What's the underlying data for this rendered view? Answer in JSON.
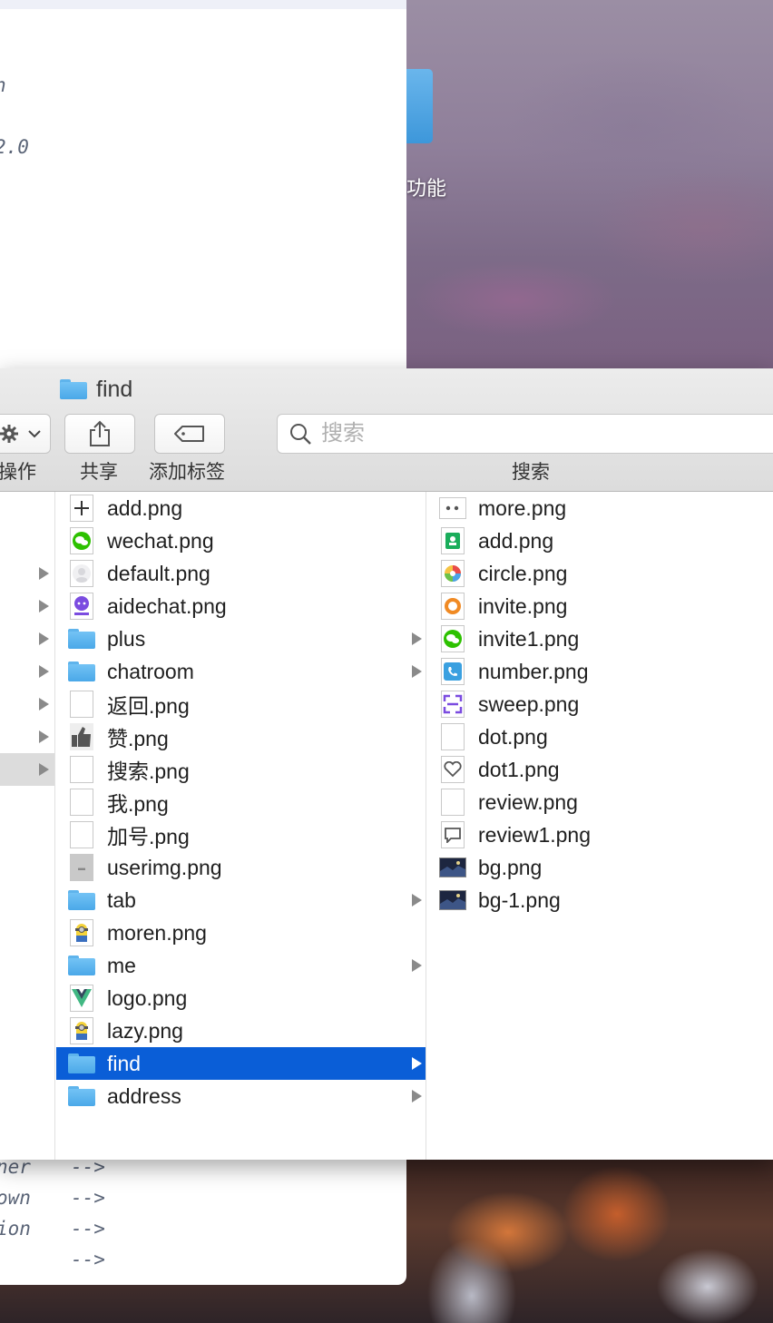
{
  "editor": {
    "lines": [
      "n",
      "2.0"
    ],
    "bottom_lines": [
      {
        "left": "ner",
        "right": "-->"
      },
      {
        "left": "own",
        "right": "-->"
      },
      {
        "left": "ion",
        "right": "-->"
      },
      {
        "left": "",
        "right": "-->"
      }
    ]
  },
  "desktop": {
    "folder_label": "功能"
  },
  "finder": {
    "title": "find",
    "toolbar": {
      "action_label": "操作",
      "share_label": "共享",
      "tag_label": "添加标签",
      "search_label": "搜索",
      "search_placeholder": "搜索"
    },
    "column1_rows": [
      {
        "arrow": false,
        "selected": false
      },
      {
        "arrow": false,
        "selected": false
      },
      {
        "arrow": true,
        "selected": false
      },
      {
        "arrow": true,
        "selected": false
      },
      {
        "arrow": true,
        "selected": false
      },
      {
        "arrow": true,
        "selected": false
      },
      {
        "arrow": true,
        "selected": false
      },
      {
        "arrow": true,
        "selected": false
      },
      {
        "arrow": true,
        "selected": true
      }
    ],
    "column2": [
      {
        "name": "add.png",
        "kind": "plus-icon",
        "folder": false
      },
      {
        "name": "wechat.png",
        "kind": "wechat-icon",
        "folder": false
      },
      {
        "name": "default.png",
        "kind": "default-avatar-icon",
        "folder": false
      },
      {
        "name": "aidechat.png",
        "kind": "aidechat-icon",
        "folder": false
      },
      {
        "name": "plus",
        "kind": "folder-icon",
        "folder": true
      },
      {
        "name": "chatroom",
        "kind": "folder-icon",
        "folder": true
      },
      {
        "name": "返回.png",
        "kind": "blank-file-icon",
        "folder": false
      },
      {
        "name": "赞.png",
        "kind": "thumbs-up-icon",
        "folder": false
      },
      {
        "name": "搜索.png",
        "kind": "blank-file-icon",
        "folder": false
      },
      {
        "name": "我.png",
        "kind": "blank-file-icon",
        "folder": false
      },
      {
        "name": "加号.png",
        "kind": "blank-file-icon",
        "folder": false
      },
      {
        "name": "userimg.png",
        "kind": "gray-image-icon",
        "folder": false
      },
      {
        "name": "tab",
        "kind": "folder-icon",
        "folder": true
      },
      {
        "name": "moren.png",
        "kind": "minion-icon",
        "folder": false
      },
      {
        "name": "me",
        "kind": "folder-icon",
        "folder": true
      },
      {
        "name": "logo.png",
        "kind": "vue-logo-icon",
        "folder": false
      },
      {
        "name": "lazy.png",
        "kind": "minion-icon",
        "folder": false
      },
      {
        "name": "find",
        "kind": "folder-icon",
        "folder": true,
        "selected": true
      },
      {
        "name": "address",
        "kind": "folder-icon",
        "folder": true
      }
    ],
    "column3": [
      {
        "name": "more.png",
        "kind": "more-dots-icon"
      },
      {
        "name": "add.png",
        "kind": "green-contact-icon"
      },
      {
        "name": "circle.png",
        "kind": "color-wheel-icon"
      },
      {
        "name": "invite.png",
        "kind": "orange-ring-icon"
      },
      {
        "name": "invite1.png",
        "kind": "wechat-icon"
      },
      {
        "name": "number.png",
        "kind": "phone-icon"
      },
      {
        "name": "sweep.png",
        "kind": "scan-icon"
      },
      {
        "name": "dot.png",
        "kind": "blank-file-icon"
      },
      {
        "name": "dot1.png",
        "kind": "heart-icon"
      },
      {
        "name": "review.png",
        "kind": "blank-file-icon"
      },
      {
        "name": "review1.png",
        "kind": "comment-icon"
      },
      {
        "name": "bg.png",
        "kind": "dark-photo-icon"
      },
      {
        "name": "bg-1.png",
        "kind": "dark-photo-icon"
      }
    ]
  }
}
